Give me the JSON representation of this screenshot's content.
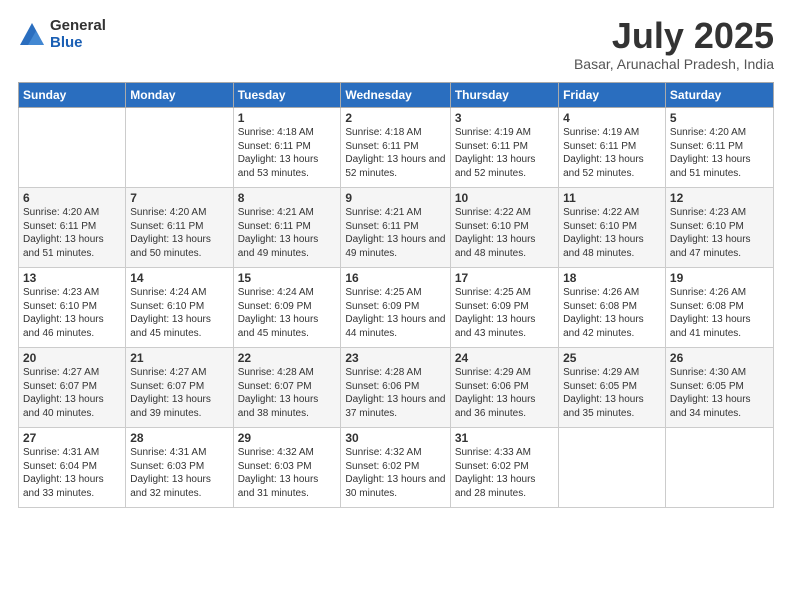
{
  "logo": {
    "general": "General",
    "blue": "Blue"
  },
  "title": "July 2025",
  "location": "Basar, Arunachal Pradesh, India",
  "days_of_week": [
    "Sunday",
    "Monday",
    "Tuesday",
    "Wednesday",
    "Thursday",
    "Friday",
    "Saturday"
  ],
  "weeks": [
    [
      {
        "day": "",
        "info": ""
      },
      {
        "day": "",
        "info": ""
      },
      {
        "day": "1",
        "info": "Sunrise: 4:18 AM\nSunset: 6:11 PM\nDaylight: 13 hours and 53 minutes."
      },
      {
        "day": "2",
        "info": "Sunrise: 4:18 AM\nSunset: 6:11 PM\nDaylight: 13 hours and 52 minutes."
      },
      {
        "day": "3",
        "info": "Sunrise: 4:19 AM\nSunset: 6:11 PM\nDaylight: 13 hours and 52 minutes."
      },
      {
        "day": "4",
        "info": "Sunrise: 4:19 AM\nSunset: 6:11 PM\nDaylight: 13 hours and 52 minutes."
      },
      {
        "day": "5",
        "info": "Sunrise: 4:20 AM\nSunset: 6:11 PM\nDaylight: 13 hours and 51 minutes."
      }
    ],
    [
      {
        "day": "6",
        "info": "Sunrise: 4:20 AM\nSunset: 6:11 PM\nDaylight: 13 hours and 51 minutes."
      },
      {
        "day": "7",
        "info": "Sunrise: 4:20 AM\nSunset: 6:11 PM\nDaylight: 13 hours and 50 minutes."
      },
      {
        "day": "8",
        "info": "Sunrise: 4:21 AM\nSunset: 6:11 PM\nDaylight: 13 hours and 49 minutes."
      },
      {
        "day": "9",
        "info": "Sunrise: 4:21 AM\nSunset: 6:11 PM\nDaylight: 13 hours and 49 minutes."
      },
      {
        "day": "10",
        "info": "Sunrise: 4:22 AM\nSunset: 6:10 PM\nDaylight: 13 hours and 48 minutes."
      },
      {
        "day": "11",
        "info": "Sunrise: 4:22 AM\nSunset: 6:10 PM\nDaylight: 13 hours and 48 minutes."
      },
      {
        "day": "12",
        "info": "Sunrise: 4:23 AM\nSunset: 6:10 PM\nDaylight: 13 hours and 47 minutes."
      }
    ],
    [
      {
        "day": "13",
        "info": "Sunrise: 4:23 AM\nSunset: 6:10 PM\nDaylight: 13 hours and 46 minutes."
      },
      {
        "day": "14",
        "info": "Sunrise: 4:24 AM\nSunset: 6:10 PM\nDaylight: 13 hours and 45 minutes."
      },
      {
        "day": "15",
        "info": "Sunrise: 4:24 AM\nSunset: 6:09 PM\nDaylight: 13 hours and 45 minutes."
      },
      {
        "day": "16",
        "info": "Sunrise: 4:25 AM\nSunset: 6:09 PM\nDaylight: 13 hours and 44 minutes."
      },
      {
        "day": "17",
        "info": "Sunrise: 4:25 AM\nSunset: 6:09 PM\nDaylight: 13 hours and 43 minutes."
      },
      {
        "day": "18",
        "info": "Sunrise: 4:26 AM\nSunset: 6:08 PM\nDaylight: 13 hours and 42 minutes."
      },
      {
        "day": "19",
        "info": "Sunrise: 4:26 AM\nSunset: 6:08 PM\nDaylight: 13 hours and 41 minutes."
      }
    ],
    [
      {
        "day": "20",
        "info": "Sunrise: 4:27 AM\nSunset: 6:07 PM\nDaylight: 13 hours and 40 minutes."
      },
      {
        "day": "21",
        "info": "Sunrise: 4:27 AM\nSunset: 6:07 PM\nDaylight: 13 hours and 39 minutes."
      },
      {
        "day": "22",
        "info": "Sunrise: 4:28 AM\nSunset: 6:07 PM\nDaylight: 13 hours and 38 minutes."
      },
      {
        "day": "23",
        "info": "Sunrise: 4:28 AM\nSunset: 6:06 PM\nDaylight: 13 hours and 37 minutes."
      },
      {
        "day": "24",
        "info": "Sunrise: 4:29 AM\nSunset: 6:06 PM\nDaylight: 13 hours and 36 minutes."
      },
      {
        "day": "25",
        "info": "Sunrise: 4:29 AM\nSunset: 6:05 PM\nDaylight: 13 hours and 35 minutes."
      },
      {
        "day": "26",
        "info": "Sunrise: 4:30 AM\nSunset: 6:05 PM\nDaylight: 13 hours and 34 minutes."
      }
    ],
    [
      {
        "day": "27",
        "info": "Sunrise: 4:31 AM\nSunset: 6:04 PM\nDaylight: 13 hours and 33 minutes."
      },
      {
        "day": "28",
        "info": "Sunrise: 4:31 AM\nSunset: 6:03 PM\nDaylight: 13 hours and 32 minutes."
      },
      {
        "day": "29",
        "info": "Sunrise: 4:32 AM\nSunset: 6:03 PM\nDaylight: 13 hours and 31 minutes."
      },
      {
        "day": "30",
        "info": "Sunrise: 4:32 AM\nSunset: 6:02 PM\nDaylight: 13 hours and 30 minutes."
      },
      {
        "day": "31",
        "info": "Sunrise: 4:33 AM\nSunset: 6:02 PM\nDaylight: 13 hours and 28 minutes."
      },
      {
        "day": "",
        "info": ""
      },
      {
        "day": "",
        "info": ""
      }
    ]
  ]
}
